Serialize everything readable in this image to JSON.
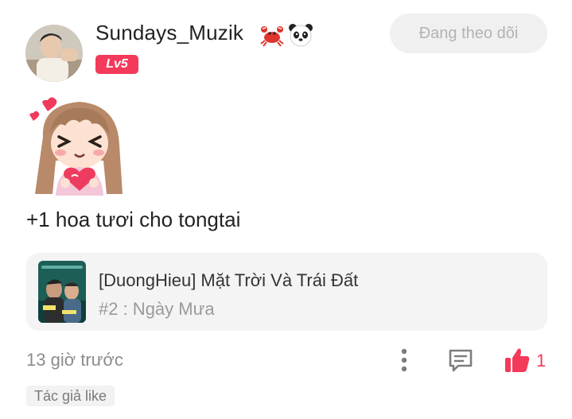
{
  "post": {
    "username": "Sundays_Muzik",
    "emojis": [
      "crab-icon",
      "panda-icon"
    ],
    "level": "Lv5",
    "follow_label": "Đang theo dõi",
    "comment": "+1 hoa tươi cho tongtai",
    "sticker": "girl-holding-heart-sticker"
  },
  "song": {
    "title": "[DuongHieu] Mặt Trời Và Trái Đất",
    "subtitle": "#2 : Ngày Mưa"
  },
  "footer": {
    "timestamp": "13 giờ trước",
    "like_count": "1",
    "author_like": "Tác giả like"
  },
  "colors": {
    "accent": "#f43a5a",
    "follow_bg": "#f0f0f0",
    "card_bg": "#f4f4f4",
    "muted_text": "#8c8c8c"
  }
}
